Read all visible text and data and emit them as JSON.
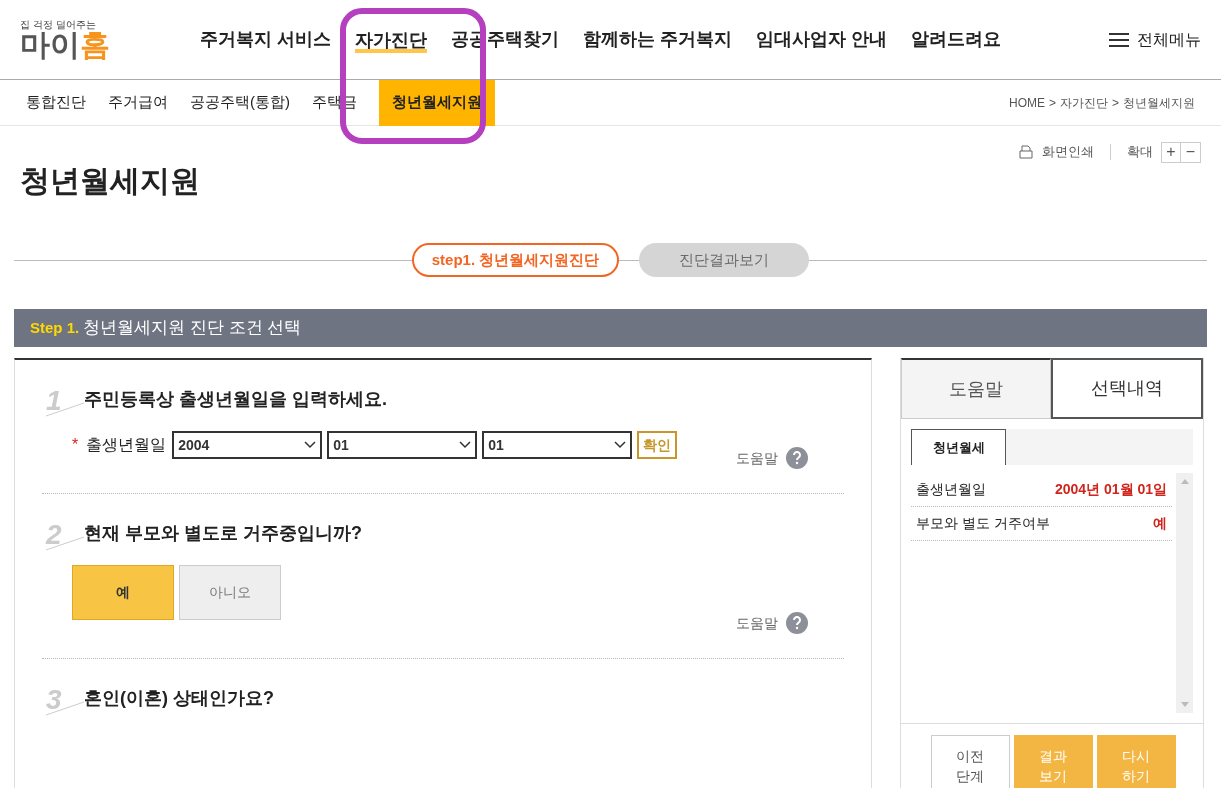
{
  "logo": {
    "tagline": "집 걱정 덜어주는",
    "name_part1": "마이",
    "name_part2": "홈"
  },
  "main_nav": [
    {
      "label": "주거복지 서비스",
      "selected": false
    },
    {
      "label": "자가진단",
      "selected": true
    },
    {
      "label": "공공주택찾기",
      "selected": false
    },
    {
      "label": "함께하는 주거복지",
      "selected": false
    },
    {
      "label": "임대사업자 안내",
      "selected": false
    },
    {
      "label": "알려드려요",
      "selected": false
    }
  ],
  "all_menu": "전체메뉴",
  "sub_nav": [
    {
      "label": "통합진단",
      "selected": false
    },
    {
      "label": "주거급여",
      "selected": false
    },
    {
      "label": "공공주택(통합)",
      "selected": false
    },
    {
      "label": "주택금",
      "selected": false
    },
    {
      "label": "청년월세지원",
      "selected": true
    }
  ],
  "breadcrumb": [
    {
      "label": "HOME",
      "separator": ">"
    },
    {
      "label": "자가진단",
      "separator": ">"
    },
    {
      "label": "청년월세지원"
    }
  ],
  "tools": {
    "print": "화면인쇄",
    "zoom": "확대",
    "zoom_in": "+",
    "zoom_out": "−"
  },
  "page_title": "청년월세지원",
  "steps": [
    {
      "label": "step1. 청년월세지원진단",
      "selected": true
    },
    {
      "label": "진단결과보기",
      "selected": false
    }
  ],
  "section": {
    "step": "Step 1.",
    "title": "청년월세지원 진단 조건 선택"
  },
  "questions": [
    {
      "number": "1",
      "kind": "date",
      "text": "주민등록상 출생년월일을 입력하세요.",
      "required_mark": "*",
      "field_label": "출생년월일",
      "selects": [
        "2004",
        "01",
        "01"
      ],
      "confirm": "확인",
      "help": "도움말"
    },
    {
      "number": "2",
      "kind": "choice",
      "text": "현재 부모와 별도로 거주중입니까?",
      "options": [
        {
          "label": "예",
          "selected": true
        },
        {
          "label": "아니오",
          "selected": false
        }
      ],
      "help": "도움말"
    },
    {
      "number": "3",
      "kind": "choice",
      "text": "혼인(이혼) 상태인가요?"
    }
  ],
  "side_tabs": [
    {
      "label": "도움말",
      "selected": false
    },
    {
      "label": "선택내역",
      "selected": true
    }
  ],
  "inner_tab": "청년월세",
  "selections": [
    {
      "label": "출생년월일",
      "value": "2004년 01월 01일"
    },
    {
      "label": "부모와 별도 거주여부",
      "value": "예"
    }
  ],
  "side_buttons": [
    {
      "label": "이전\n단계",
      "kind": "outline"
    },
    {
      "label": "결과\n보기",
      "kind": "filled"
    },
    {
      "label": "다시\n하기",
      "kind": "filled"
    }
  ]
}
